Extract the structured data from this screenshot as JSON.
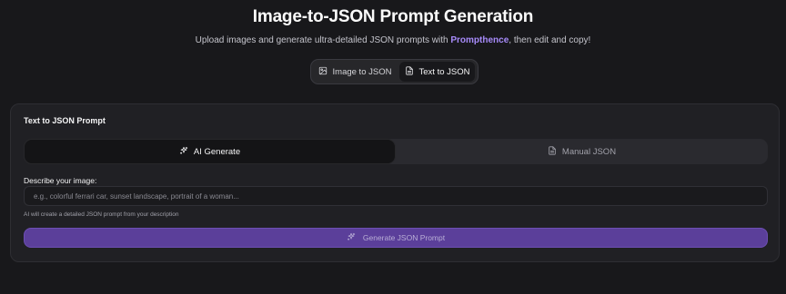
{
  "header": {
    "title": "Image-to-JSON Prompt Generation",
    "subtitle_before": "Upload images and generate ultra-detailed JSON prompts with ",
    "subtitle_brand": "Prompthence",
    "subtitle_after": ", then edit and copy!"
  },
  "mode_switch": {
    "image_label": "Image to JSON",
    "text_label": "Text to JSON",
    "active": "text"
  },
  "card": {
    "title": "Text to JSON Prompt",
    "tabs": {
      "ai_label": "AI Generate",
      "manual_label": "Manual JSON",
      "active": "ai"
    },
    "field_label": "Describe your image:",
    "input_value": "",
    "input_placeholder": "e.g., colorful ferrari car, sunset landscape, portrait of a woman...",
    "helper": "AI will create a detailed JSON prompt from your description",
    "generate_label": "Generate JSON Prompt"
  },
  "colors": {
    "background": "#18181b",
    "card": "#202024",
    "accent": "#a78bfa",
    "button": "#5b3f9a"
  },
  "icons": {
    "image_tab": "image-icon",
    "text_tab": "file-text-icon",
    "ai_tab": "sparkles-icon",
    "manual_tab": "file-text-icon",
    "generate": "sparkles-icon"
  }
}
